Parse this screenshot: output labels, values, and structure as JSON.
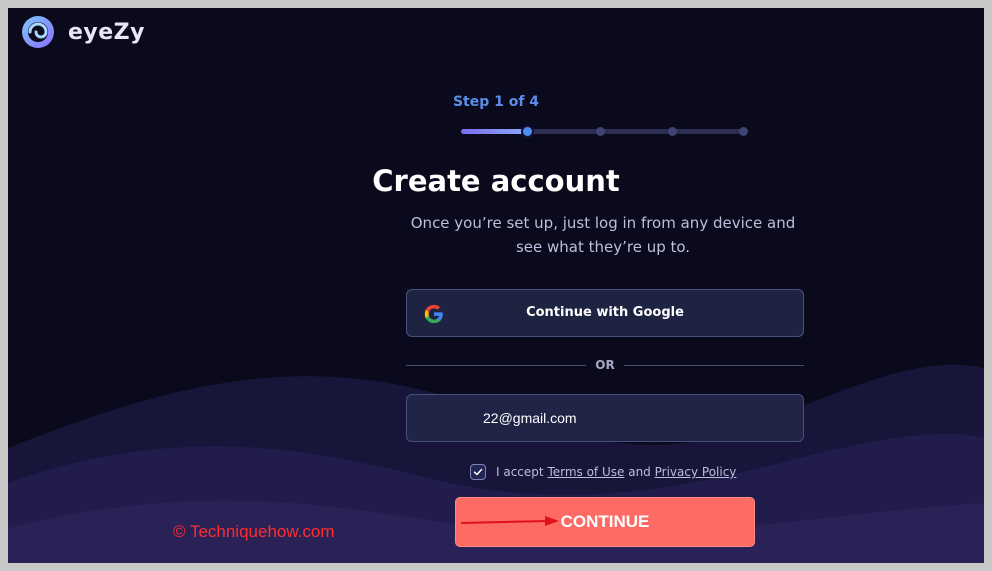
{
  "brand": {
    "name": "eyeZy",
    "logo_icon": "eye-swirl-logo-icon"
  },
  "onboarding": {
    "step_text": "Step 1 of 4",
    "progress": {
      "current_step": 1,
      "total_steps": 4,
      "fill_fraction": 0.23
    },
    "title": "Create account",
    "subtitle": "Once you’re set up, just log in from any device and see what they’re up to."
  },
  "google_button": {
    "label": "Continue with Google",
    "icon": "google-icon"
  },
  "divider": {
    "label": "OR"
  },
  "email_field": {
    "value": "22@gmail.com"
  },
  "terms": {
    "checked": true,
    "prefix": "I accept",
    "terms_link": "Terms of Use",
    "conjunction": "and",
    "privacy_link": "Privacy Policy"
  },
  "continue_button": {
    "label": "CONTINUE"
  },
  "annotation": {
    "watermark": "© Techniquehow.com",
    "arrow_color": "#e0111b"
  },
  "colors": {
    "background": "#0a0a1c",
    "accent": "#5b8dea",
    "cta": "#fd6b64",
    "input_bg": "#202446"
  }
}
